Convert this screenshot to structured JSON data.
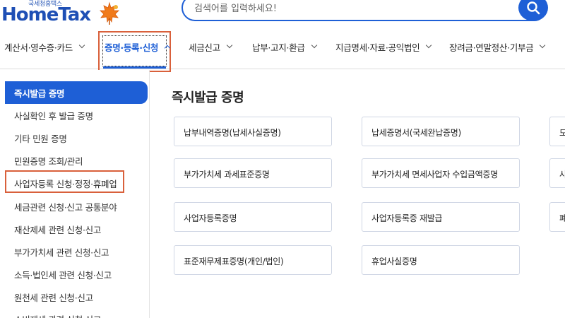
{
  "header": {
    "logo_small": "국세청홈택스",
    "logo_main": "HomeTax",
    "search_placeholder": "검색어를 입력하세요!"
  },
  "nav": {
    "items": [
      {
        "label": "계산서·영수증·카드"
      },
      {
        "label": "증명·등록·신청"
      },
      {
        "label": "세금신고"
      },
      {
        "label": "납부·고지·환급"
      },
      {
        "label": "지급명세·자료·공익법인"
      },
      {
        "label": "장려금·연말정산·기부금"
      }
    ],
    "active_index": 1
  },
  "sidebar": {
    "items": [
      {
        "label": "즉시발급 증명"
      },
      {
        "label": "사실확인 후 발급 증명"
      },
      {
        "label": "기타 민원 증명"
      },
      {
        "label": "민원증명 조회/관리"
      },
      {
        "label": "사업자등록 신청·정정·휴폐업"
      },
      {
        "label": "세금관련 신청·신고 공통분야"
      },
      {
        "label": "재산제세 관련 신청·신고"
      },
      {
        "label": "부가가치세 관련 신청·신고"
      },
      {
        "label": "소득·법인세 관련 신청·신고"
      },
      {
        "label": "원천세 관련 신청·신고"
      },
      {
        "label": "소비제세 관련 신청·신고"
      }
    ],
    "active_index": 0,
    "highlighted_index": 4
  },
  "main": {
    "title": "즉시발급 증명",
    "cards": [
      {
        "label": "납부내역증명(납세사실증명)"
      },
      {
        "label": "납세증명서(국세완납증명)"
      },
      {
        "label": "모"
      },
      {
        "label": "부가가치세 과세표준증명"
      },
      {
        "label": "부가가치세 면세사업자 수입금액증명"
      },
      {
        "label": "사"
      },
      {
        "label": "사업자등록증명"
      },
      {
        "label": "사업자등록증 재발급"
      },
      {
        "label": "폐"
      },
      {
        "label": "표준재무제표증명(개인/법인)"
      },
      {
        "label": "휴업사실증명"
      }
    ]
  },
  "colors": {
    "brand_blue": "#1e5fd6",
    "highlight_orange": "#d9603b"
  },
  "icons": {
    "search": "search-icon",
    "leaf": "maple-leaf-icon"
  }
}
